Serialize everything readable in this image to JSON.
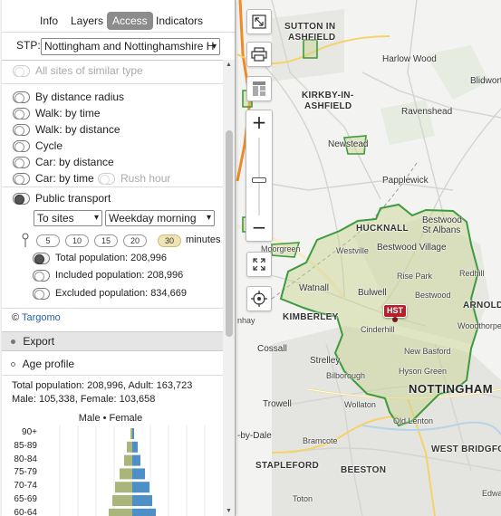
{
  "panel": {
    "tabs": [
      {
        "label": "Info"
      },
      {
        "label": "Layers"
      },
      {
        "label": "Access"
      },
      {
        "label": "Indicators"
      }
    ],
    "stp_label": "STP:",
    "stp_value": "Nottingham and Nottinghamshire H",
    "all_sites_label": "All sites of similar type",
    "travel_options": [
      {
        "label": "By distance radius"
      },
      {
        "label": "Walk: by time"
      },
      {
        "label": "Walk: by distance"
      },
      {
        "label": "Cycle"
      },
      {
        "label": "Car: by distance"
      },
      {
        "label": "Car: by time"
      },
      {
        "label": "Public transport"
      }
    ],
    "rush_hour_label": "Rush hour",
    "direction_select": "To sites",
    "time_select": "Weekday morning",
    "minute_options": [
      "5",
      "10",
      "15",
      "20",
      "30"
    ],
    "selected_minutes": "30",
    "minutes_label": "minutes",
    "population_options": [
      {
        "label": "Total population: 208,996"
      },
      {
        "label": "Included population: 208,996"
      },
      {
        "label": "Excluded population: 834,669"
      }
    ],
    "credit_prefix": "©",
    "credit_link": "Targomo",
    "export_label": "Export",
    "age_profile_label": "Age profile",
    "stats_line1": "Total population: 208,996, Adult: 163,723",
    "stats_line2": "Male: 105,338, Female: 103,658",
    "pyramid": {
      "title": "Male • Female",
      "male_color": "#a9b57a",
      "female_color": "#4f8fc8",
      "age_bands": [
        "90+",
        "85-89",
        "80-84",
        "75-79",
        "70-74",
        "65-69",
        "60-64"
      ]
    }
  },
  "map": {
    "site_marker": "HST",
    "catchment_color": "#3e9a3e",
    "places": [
      {
        "text": "SUTTON IN",
        "cls": "big"
      },
      {
        "text": "ASHFIELD",
        "cls": "big"
      },
      {
        "text": "Harlow Wood",
        "cls": "mid"
      },
      {
        "text": "Blidworth",
        "cls": "mid"
      },
      {
        "text": "KIRKBY-IN-",
        "cls": "big"
      },
      {
        "text": "ASHFIELD",
        "cls": "big"
      },
      {
        "text": "Ravenshead",
        "cls": "mid"
      },
      {
        "text": "Newstead",
        "cls": "mid"
      },
      {
        "text": "Papplewick",
        "cls": "mid"
      },
      {
        "text": "HUCKNALL",
        "cls": "big"
      },
      {
        "text": "Bestwood",
        "cls": "mid"
      },
      {
        "text": "St Albans",
        "cls": "mid"
      },
      {
        "text": "Westville",
        "cls": "small"
      },
      {
        "text": "Bestwood Village",
        "cls": "mid"
      },
      {
        "text": "Moorgreen",
        "cls": "small"
      },
      {
        "text": "Rise Park",
        "cls": "small"
      },
      {
        "text": "Redhill",
        "cls": "small"
      },
      {
        "text": "Watnall",
        "cls": "mid"
      },
      {
        "text": "Bulwell",
        "cls": "mid"
      },
      {
        "text": "Bestwood",
        "cls": "small"
      },
      {
        "text": "ARNOLD",
        "cls": "big"
      },
      {
        "text": "KIMBERLEY",
        "cls": "big"
      },
      {
        "text": "Woodthorpe",
        "cls": "small"
      },
      {
        "text": "Cinderhill",
        "cls": "small"
      },
      {
        "text": "Cossall",
        "cls": "mid"
      },
      {
        "text": "New Basford",
        "cls": "small"
      },
      {
        "text": "Strelley",
        "cls": "mid"
      },
      {
        "text": "Bilborough",
        "cls": "small"
      },
      {
        "text": "Hyson Green",
        "cls": "small"
      },
      {
        "text": "NOTTINGHAM",
        "cls": "town"
      },
      {
        "text": "Trowell",
        "cls": "mid"
      },
      {
        "text": "Wollaton",
        "cls": "small"
      },
      {
        "text": "Old Lenton",
        "cls": "small"
      },
      {
        "text": "Bramcote",
        "cls": "small"
      },
      {
        "text": "WEST BRIDGFORD",
        "cls": "big"
      },
      {
        "text": "STAPLEFORD",
        "cls": "big"
      },
      {
        "text": "BEESTON",
        "cls": "big"
      },
      {
        "text": "Toton",
        "cls": "small"
      },
      {
        "text": "-by-Dale",
        "cls": "mid"
      },
      {
        "text": "nhay",
        "cls": "small"
      },
      {
        "text": "Edwalton",
        "cls": "small"
      }
    ]
  }
}
